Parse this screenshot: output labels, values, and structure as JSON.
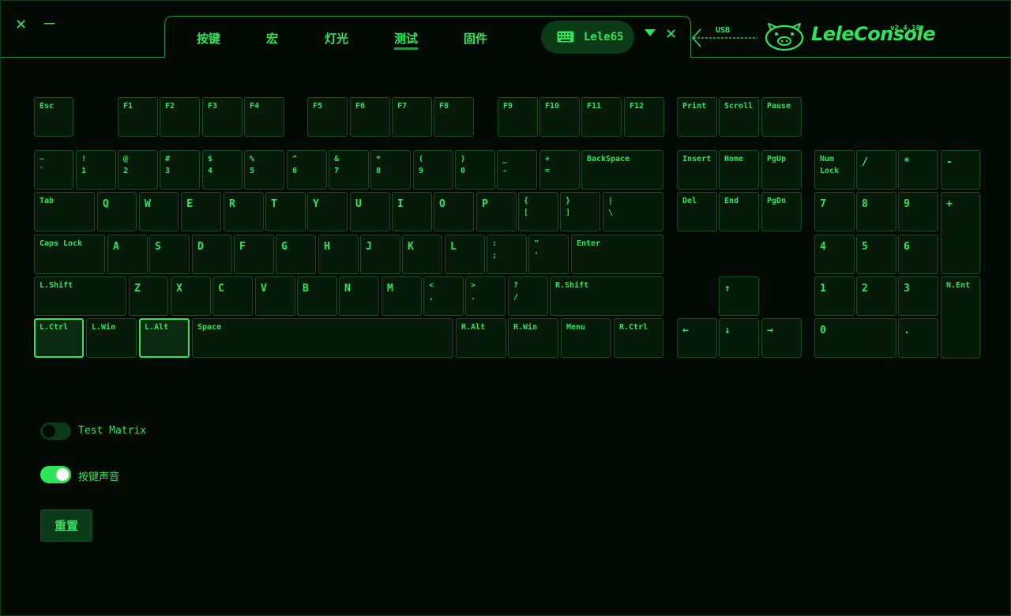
{
  "window_controls": {
    "close": "✕",
    "minimize": "—"
  },
  "tabs": [
    {
      "label": "按键",
      "active": false
    },
    {
      "label": "宏",
      "active": false
    },
    {
      "label": "灯光",
      "active": false
    },
    {
      "label": "测试",
      "active": true
    },
    {
      "label": "固件",
      "active": false
    }
  ],
  "device": {
    "name": "Lele65",
    "close": "✕"
  },
  "connection": {
    "label": "USB"
  },
  "brand": {
    "name": "LeleConsole",
    "version": "v2.4.18"
  },
  "colors": {
    "accent": "#2ee55a",
    "background": "#020a03",
    "key_bg": "#061a0a",
    "key_border": "#154d22",
    "pill_bg": "#0b3a17"
  },
  "keys": {
    "esc": {
      "l1": "Esc"
    },
    "f1": {
      "l1": "F1"
    },
    "f2": {
      "l1": "F2"
    },
    "f3": {
      "l1": "F3"
    },
    "f4": {
      "l1": "F4"
    },
    "f5": {
      "l1": "F5"
    },
    "f6": {
      "l1": "F6"
    },
    "f7": {
      "l1": "F7"
    },
    "f8": {
      "l1": "F8"
    },
    "f9": {
      "l1": "F9"
    },
    "f10": {
      "l1": "F10"
    },
    "f11": {
      "l1": "F11"
    },
    "f12": {
      "l1": "F12"
    },
    "print": {
      "l1": "Print"
    },
    "scroll": {
      "l1": "Scroll"
    },
    "pause": {
      "l1": "Pause"
    },
    "grave": {
      "l1": "~",
      "l2": "`"
    },
    "d1": {
      "l1": "!",
      "l2": "1"
    },
    "d2": {
      "l1": "@",
      "l2": "2"
    },
    "d3": {
      "l1": "#",
      "l2": "3"
    },
    "d4": {
      "l1": "$",
      "l2": "4"
    },
    "d5": {
      "l1": "%",
      "l2": "5"
    },
    "d6": {
      "l1": "^",
      "l2": "6"
    },
    "d7": {
      "l1": "&",
      "l2": "7"
    },
    "d8": {
      "l1": "*",
      "l2": "8"
    },
    "d9": {
      "l1": "(",
      "l2": "9"
    },
    "d0": {
      "l1": ")",
      "l2": "0"
    },
    "minus": {
      "l1": "_",
      "l2": "-"
    },
    "equal": {
      "l1": "+",
      "l2": "="
    },
    "backspace": {
      "l1": "BackSpace"
    },
    "insert": {
      "l1": "Insert"
    },
    "home": {
      "l1": "Home"
    },
    "pgup": {
      "l1": "PgUp"
    },
    "numlock": {
      "l1": "Num",
      "l2": "Lock"
    },
    "np_div": {
      "l1": "/"
    },
    "np_mul": {
      "l1": "*"
    },
    "np_sub": {
      "l1": "-"
    },
    "tab": {
      "l1": "Tab"
    },
    "q": {
      "l1": "Q"
    },
    "w": {
      "l1": "W"
    },
    "e": {
      "l1": "E"
    },
    "r": {
      "l1": "R"
    },
    "t": {
      "l1": "T"
    },
    "y": {
      "l1": "Y"
    },
    "u": {
      "l1": "U"
    },
    "i": {
      "l1": "I"
    },
    "o": {
      "l1": "O"
    },
    "p": {
      "l1": "P"
    },
    "lbracket": {
      "l1": "{",
      "l2": "["
    },
    "rbracket": {
      "l1": "}",
      "l2": "]"
    },
    "backslash": {
      "l1": "|",
      "l2": "\\"
    },
    "del": {
      "l1": "Del"
    },
    "end": {
      "l1": "End"
    },
    "pgdn": {
      "l1": "PgDn"
    },
    "np7": {
      "l1": "7"
    },
    "np8": {
      "l1": "8"
    },
    "np9": {
      "l1": "9"
    },
    "np_add": {
      "l1": "+"
    },
    "capslock": {
      "l1": "Caps Lock"
    },
    "a": {
      "l1": "A"
    },
    "s": {
      "l1": "S"
    },
    "d": {
      "l1": "D"
    },
    "f": {
      "l1": "F"
    },
    "g": {
      "l1": "G"
    },
    "h": {
      "l1": "H"
    },
    "j": {
      "l1": "J"
    },
    "k": {
      "l1": "K"
    },
    "l": {
      "l1": "L"
    },
    "semicolon": {
      "l1": ":",
      "l2": ";"
    },
    "quote": {
      "l1": "\"",
      "l2": "'"
    },
    "enter": {
      "l1": "Enter"
    },
    "np4": {
      "l1": "4"
    },
    "np5": {
      "l1": "5"
    },
    "np6": {
      "l1": "6"
    },
    "lshift": {
      "l1": "L.Shift"
    },
    "z": {
      "l1": "Z"
    },
    "x": {
      "l1": "X"
    },
    "c": {
      "l1": "C"
    },
    "v": {
      "l1": "V"
    },
    "b": {
      "l1": "B"
    },
    "n": {
      "l1": "N"
    },
    "m": {
      "l1": "M"
    },
    "comma": {
      "l1": "<",
      "l2": ","
    },
    "period": {
      "l1": ">",
      "l2": "."
    },
    "slash": {
      "l1": "?",
      "l2": "/"
    },
    "rshift": {
      "l1": "R.Shift"
    },
    "up": {
      "l1": "↑"
    },
    "np1": {
      "l1": "1"
    },
    "np2": {
      "l1": "2"
    },
    "np3": {
      "l1": "3"
    },
    "np_enter": {
      "l1": "N.Ent"
    },
    "lctrl": {
      "l1": "L.Ctrl"
    },
    "lwin": {
      "l1": "L.Win"
    },
    "lalt": {
      "l1": "L.Alt"
    },
    "space": {
      "l1": "Space"
    },
    "ralt": {
      "l1": "R.Alt"
    },
    "rwin": {
      "l1": "R.Win"
    },
    "menu": {
      "l1": "Menu"
    },
    "rctrl": {
      "l1": "R.Ctrl"
    },
    "left": {
      "l1": "←"
    },
    "down": {
      "l1": "↓"
    },
    "right": {
      "l1": "→"
    },
    "np0": {
      "l1": "0"
    },
    "np_dot": {
      "l1": "."
    }
  },
  "pressed_keys": [
    "lctrl",
    "lalt"
  ],
  "options": {
    "test_matrix": {
      "label": "Test Matrix",
      "enabled": false
    },
    "key_sound": {
      "label": "按键声音",
      "enabled": true
    }
  },
  "reset_button": {
    "label": "重置"
  }
}
